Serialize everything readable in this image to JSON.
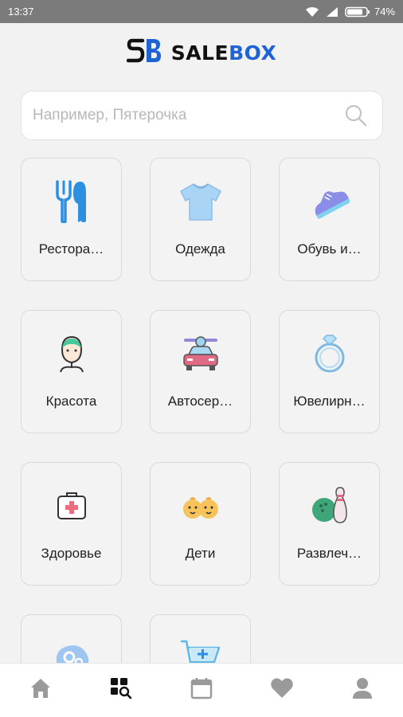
{
  "status_bar": {
    "time": "13:37",
    "battery": "74%"
  },
  "brand": {
    "logo_text": "SB",
    "name_part1": "SALE",
    "name_part2": "BOX",
    "accent_color": "#1e64d6"
  },
  "search": {
    "placeholder": "Например, Пятерочка",
    "value": ""
  },
  "categories": [
    {
      "label": "Рестора…",
      "icon": "fork-knife-icon"
    },
    {
      "label": "Одежда",
      "icon": "tshirt-icon"
    },
    {
      "label": "Обувь и…",
      "icon": "sneaker-icon"
    },
    {
      "label": "Красота",
      "icon": "face-mask-icon"
    },
    {
      "label": "Автосер…",
      "icon": "car-service-icon"
    },
    {
      "label": "Ювелирн…",
      "icon": "ring-icon"
    },
    {
      "label": "Здоровье",
      "icon": "first-aid-kit-icon"
    },
    {
      "label": "Дети",
      "icon": "kids-icon"
    },
    {
      "label": "Развлеч…",
      "icon": "bowling-icon"
    },
    {
      "label": "",
      "icon": "brain-gears-icon"
    },
    {
      "label": "",
      "icon": "shopping-cart-icon"
    }
  ],
  "bottom_nav": [
    {
      "icon": "home-icon",
      "active": false
    },
    {
      "icon": "catalog-search-icon",
      "active": true
    },
    {
      "icon": "calendar-icon",
      "active": false
    },
    {
      "icon": "heart-icon",
      "active": false
    },
    {
      "icon": "profile-icon",
      "active": false
    }
  ]
}
